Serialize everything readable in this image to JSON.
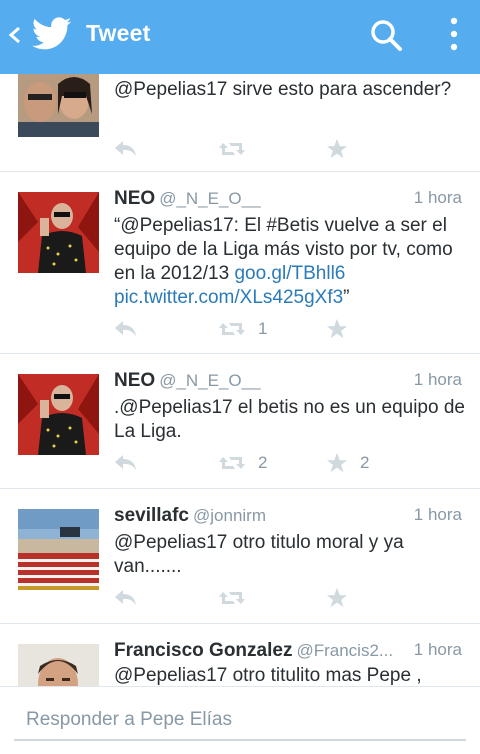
{
  "appbar": {
    "title": "Tweet",
    "back_icon": "back-chevron-icon",
    "logo_icon": "twitter-bird-icon",
    "search_icon": "search-icon",
    "more_icon": "overflow-menu-icon",
    "background": "#55acee"
  },
  "tweets": [
    {
      "name": "",
      "handle": "",
      "time": "",
      "text_plain": "@Pepelias17 sirve esto para ascender?",
      "retweets": "",
      "favorites": ""
    },
    {
      "name": "NEO",
      "handle": "@_N_E_O__",
      "time": "1 hora",
      "text_plain": "“@Pepelias17: El #Betis vuelve a ser el equipo de la Liga más visto por tv, como en la 2012/13 ",
      "link1": "goo.gl/TBhll6",
      "link2": "pic.twitter.com/XLs425gXf3",
      "text_end": "”",
      "retweets": "1",
      "favorites": ""
    },
    {
      "name": "NEO",
      "handle": "@_N_E_O__",
      "time": "1 hora",
      "text_plain": ".@Pepelias17 el betis no es un equipo de La Liga.",
      "retweets": "2",
      "favorites": "2"
    },
    {
      "name": "sevillafc",
      "handle": "@jonnirm",
      "time": "1 hora",
      "text_plain": "@Pepelias17 otro titulo moral y ya van.......",
      "retweets": "",
      "favorites": ""
    },
    {
      "name": "Francisco Gonzalez",
      "handle": "@Francis2...",
      "time": "1 hora",
      "text_plain": "@Pepelias17 otro titulito mas Pepe ,",
      "retweets": "",
      "favorites": ""
    }
  ],
  "reply": {
    "placeholder": "Responder a Pepe Elías"
  },
  "colors": {
    "link": "#2b7bb9",
    "muted": "#8899a6",
    "action_icon": "#cfd9de"
  }
}
